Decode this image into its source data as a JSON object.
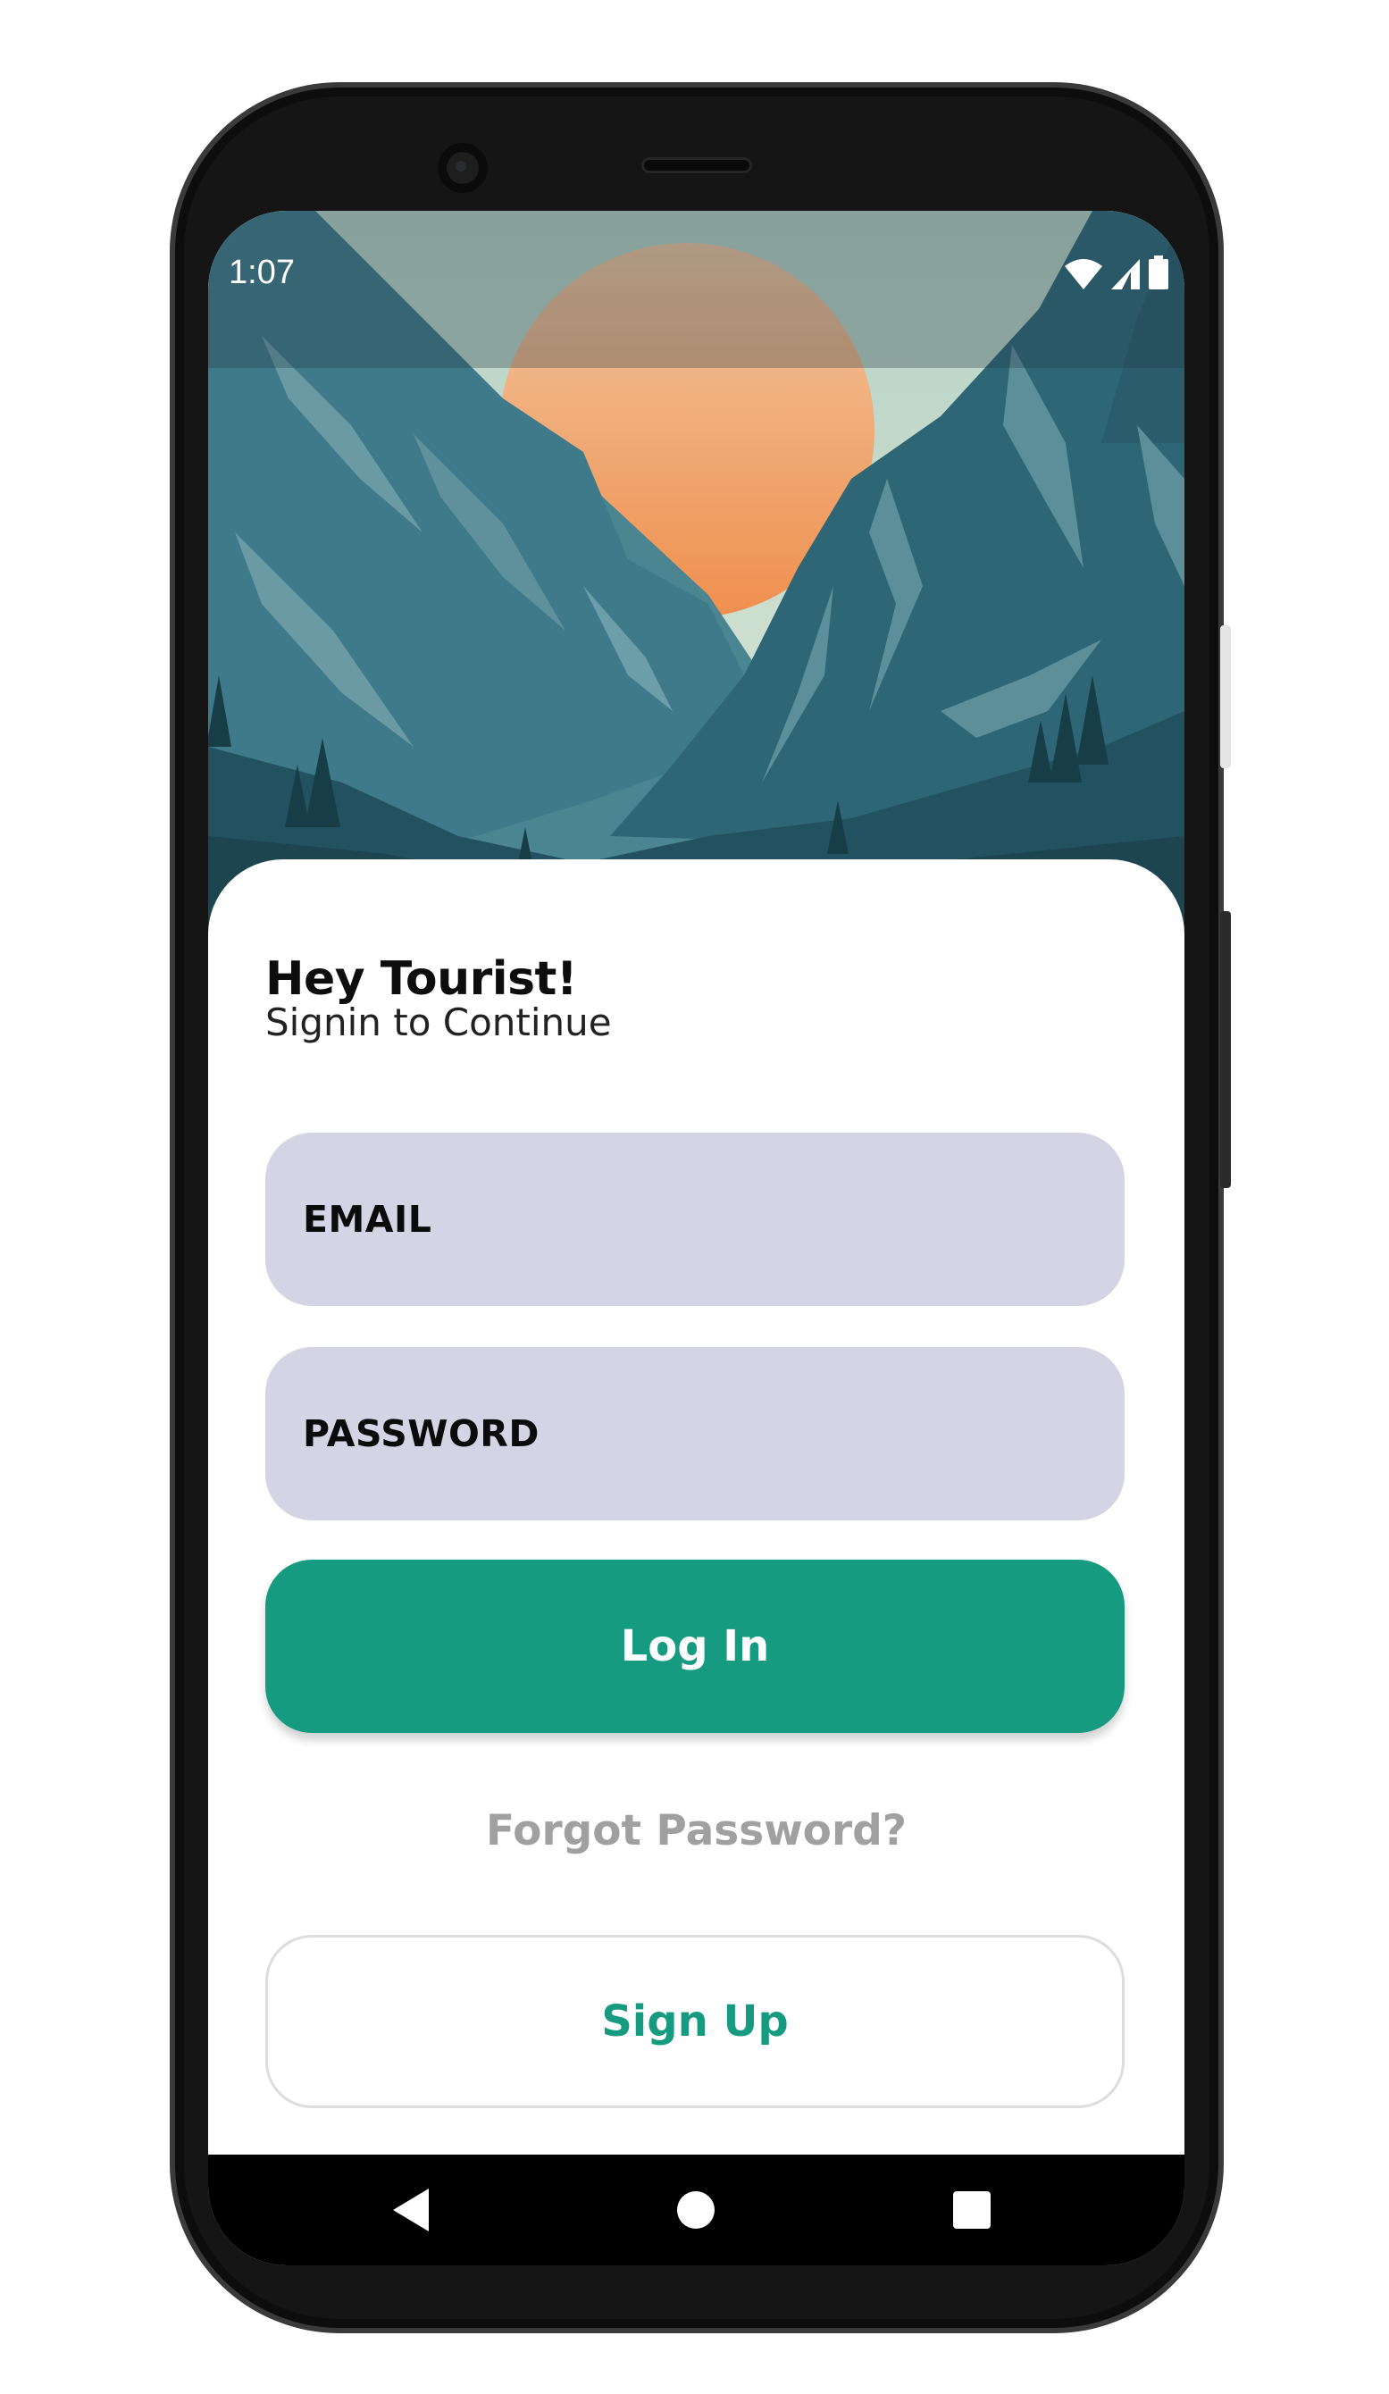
{
  "status_bar": {
    "time": "1:07",
    "icons": [
      "wifi-icon",
      "signal-icon",
      "battery-icon"
    ]
  },
  "login": {
    "greeting": "Hey Tourist!",
    "subtitle": "Signin to Continue",
    "email_placeholder": "EMAIL",
    "password_placeholder": "PASSWORD",
    "login_label": "Log In",
    "forgot_label": "Forgot Password?",
    "signup_label": "Sign Up"
  },
  "nav_bar": {
    "icons": [
      "back-icon",
      "home-icon",
      "recents-icon"
    ]
  },
  "colors": {
    "accent": "#179b80",
    "field_background": "#d5d4e4",
    "link_gray": "#a0a0a0",
    "hero_sky": "#a9cbbd",
    "hero_sun": "#f2a65e",
    "hero_mountain": "#356f80"
  }
}
